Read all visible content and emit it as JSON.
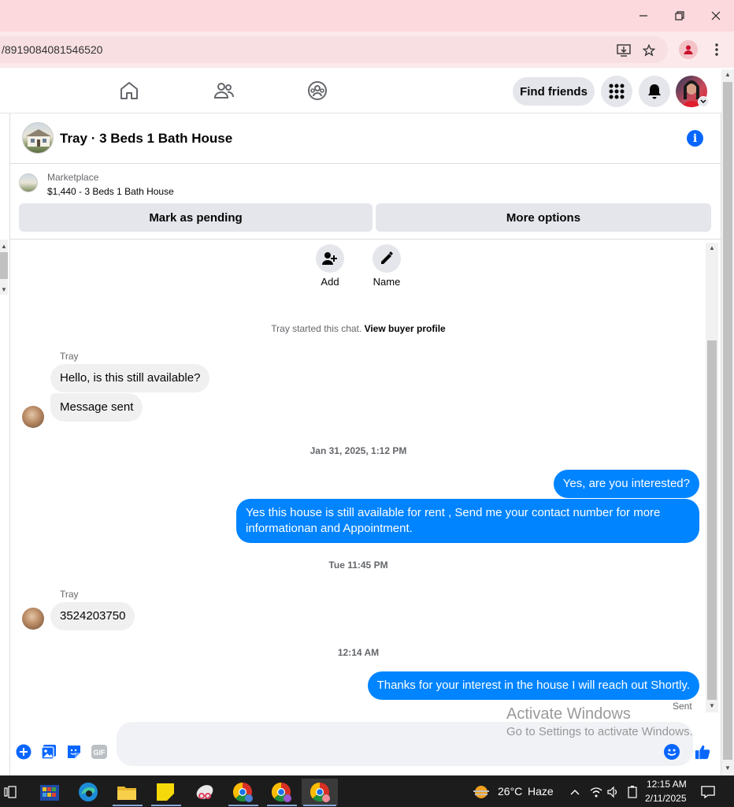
{
  "browser": {
    "url": "/8919084081546520",
    "window_controls": [
      "minimize",
      "restore",
      "close"
    ]
  },
  "fb_nav": {
    "icons": [
      "home-icon",
      "friends-icon",
      "groups-icon"
    ],
    "find_friends": "Find friends",
    "right_icons": [
      "menu-grid-icon",
      "bell-icon"
    ]
  },
  "chat": {
    "title": "Tray · 3 Beds 1 Bath House",
    "marketplace_label": "Marketplace",
    "listing": "$1,440 - 3 Beds 1 Bath House",
    "mark_pending": "Mark as pending",
    "more_options": "More options",
    "add_label": "Add",
    "name_label": "Name",
    "started_text": "Tray started this chat.",
    "view_profile": "View buyer profile",
    "messages": [
      {
        "sender": "Tray",
        "text": "Hello, is this still available?"
      },
      {
        "text": "Message sent"
      },
      {
        "stamp": "Jan 31, 2025, 1:12 PM"
      },
      {
        "out": "Yes, are you interested?"
      },
      {
        "out": "Yes this house is still available for rent , Send me your contact number for more informationan and Appointment."
      },
      {
        "stamp": "Tue 11:45 PM"
      },
      {
        "sender": "Tray",
        "text": "3524203750"
      },
      {
        "stamp": "12:14 AM"
      },
      {
        "out": "Thanks for your interest in the house I will reach out Shortly."
      }
    ],
    "sent_status": "Sent"
  },
  "watermark": {
    "line1": "Activate Windows",
    "line2": "Go to Settings to activate Windows."
  },
  "composer": {
    "icons": [
      "plus-icon",
      "photo-icon",
      "sticker-icon",
      "gif-icon",
      "emoji-icon",
      "like-icon"
    ],
    "gif_label": "GIF"
  },
  "taskbar": {
    "weather_temp": "26°C",
    "weather_desc": "Haze",
    "time": "12:15 AM",
    "date": "2/11/2025"
  },
  "colors": {
    "accent": "#0084ff",
    "fb_blue": "#0866ff",
    "titlebar": "#fcd9dc"
  }
}
